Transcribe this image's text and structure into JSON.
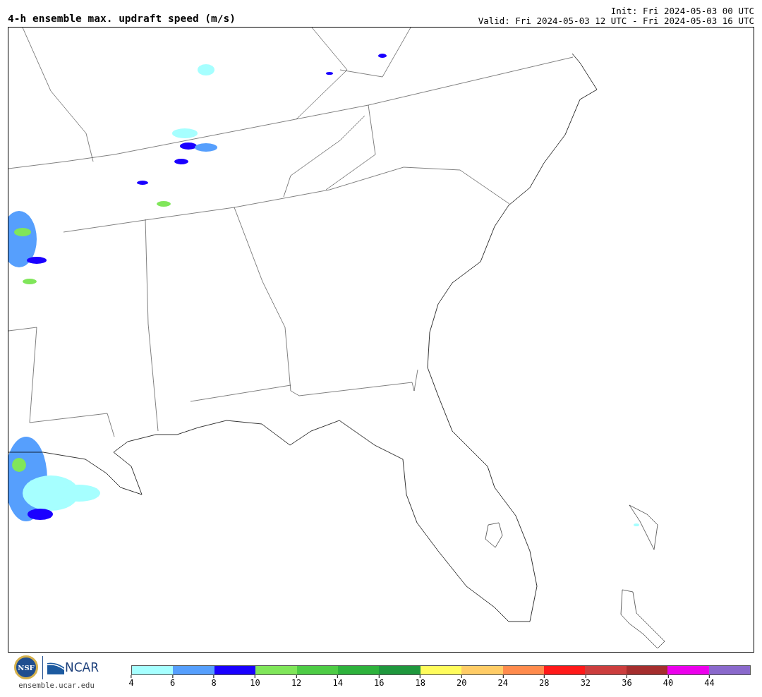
{
  "title": "4-h ensemble max. updraft speed (m/s)",
  "init": "Init: Fri 2024-05-03 00 UTC",
  "valid": "Valid: Fri 2024-05-03 12 UTC - Fri 2024-05-03 16 UTC",
  "logos": {
    "nsf": "NSF",
    "ncar": "NCAR",
    "site": "ensemble.ucar.edu"
  },
  "colorbar": {
    "segments": [
      {
        "color": "#a6ffff"
      },
      {
        "color": "#569ffd"
      },
      {
        "color": "#1a00ff"
      },
      {
        "color": "#80e65a"
      },
      {
        "color": "#4ecc45"
      },
      {
        "color": "#2eb23c"
      },
      {
        "color": "#1f973d"
      },
      {
        "color": "#fffc5c"
      },
      {
        "color": "#ffcc66"
      },
      {
        "color": "#ff8b4d"
      },
      {
        "color": "#ff1a1a"
      },
      {
        "color": "#cc3e3e"
      },
      {
        "color": "#a52e2e"
      },
      {
        "color": "#ec00ec"
      },
      {
        "color": "#8a69cc"
      }
    ],
    "ticks": [
      "4",
      "6",
      "8",
      "10",
      "12",
      "14",
      "16",
      "18",
      "20",
      "24",
      "28",
      "32",
      "36",
      "40",
      "44"
    ]
  }
}
